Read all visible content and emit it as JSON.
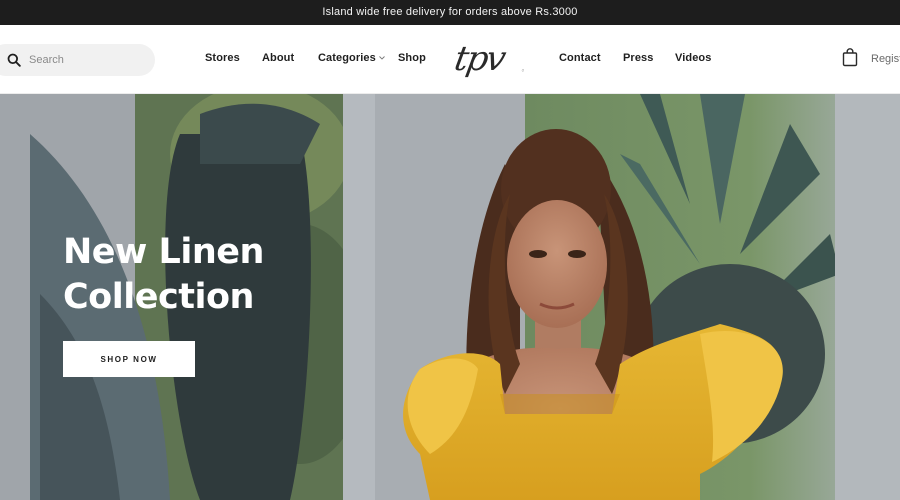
{
  "announcement": "Island wide free delivery for orders above Rs.3000",
  "search": {
    "placeholder": "Search"
  },
  "nav": {
    "left": [
      "Stores",
      "About",
      "Categories",
      "Shop"
    ],
    "right": [
      "Contact",
      "Press",
      "Videos"
    ]
  },
  "logo": "tpv",
  "header_right": {
    "register": "Register"
  },
  "hero": {
    "title_line1": "New Linen",
    "title_line2": "Collection",
    "cta": "SHOP NOW"
  },
  "icons": {
    "search": "search-icon",
    "cart": "shopping-bag-icon",
    "dropdown": "chevron-down-icon"
  },
  "colors": {
    "announcement_bg": "#1d1d1d",
    "dress_yellow": "#e2b22c",
    "hero_wall": "#9ba1a7"
  }
}
